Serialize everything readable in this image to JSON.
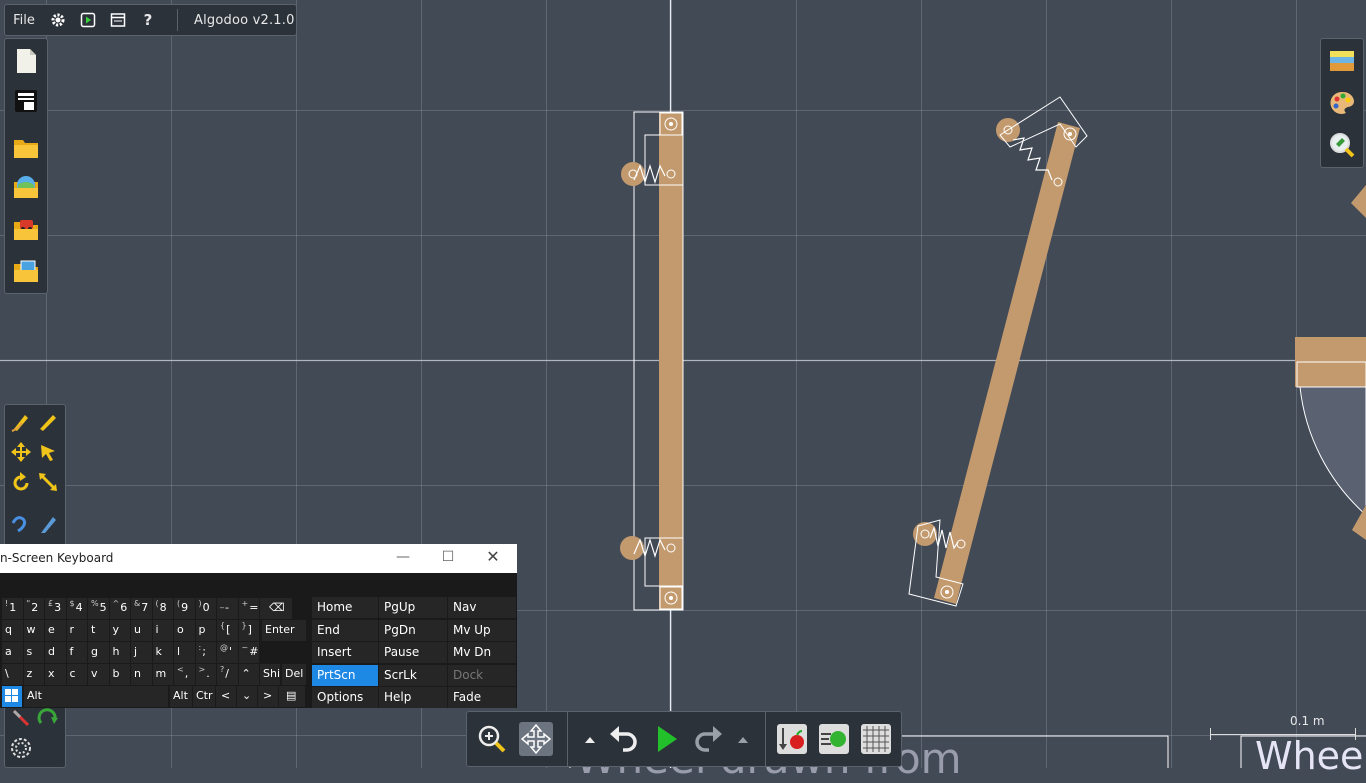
{
  "menubar": {
    "file_label": "File",
    "title": "Algodoo v2.1.0",
    "icons": [
      "gear-icon",
      "play-window-icon",
      "window-icon",
      "help-icon"
    ],
    "help_glyph": "?"
  },
  "left_toolbar": {
    "items": [
      "new-scene-icon",
      "scene-options-icon",
      "open-folder-icon",
      "open-web-icon",
      "phunlets-icon",
      "open-media-icon"
    ]
  },
  "draw_tools": {
    "items": [
      "sketch-tool-icon",
      "brush-tool-icon",
      "move-tool-icon",
      "drag-tool-icon",
      "rotate-tool-icon",
      "scale-tool-icon",
      "rope-tool-icon",
      "knife-tool-icon",
      "chain-tool-icon",
      "fixate-tool-icon",
      "spring-tool-icon"
    ]
  },
  "right_toolbar": {
    "items": [
      "background-icon",
      "palette-icon",
      "zoom-inspect-icon"
    ]
  },
  "osk": {
    "title": "n-Screen Keyboard",
    "row1": [
      {
        "sub": "!",
        "main": "1"
      },
      {
        "sub": "\"",
        "main": "2"
      },
      {
        "sub": "£",
        "main": "3"
      },
      {
        "sub": "$",
        "main": "4"
      },
      {
        "sub": "%",
        "main": "5"
      },
      {
        "sub": "^",
        "main": "6"
      },
      {
        "sub": "&",
        "main": "7"
      },
      {
        "sub": "(",
        "main": "8"
      },
      {
        "sub": "(",
        "main": "9"
      },
      {
        "sub": ")",
        "main": "0"
      },
      {
        "sub": "_",
        "main": "-"
      },
      {
        "sub": "+",
        "main": "="
      }
    ],
    "row2": [
      "q",
      "w",
      "e",
      "r",
      "t",
      "y",
      "u",
      "i",
      "o",
      "p"
    ],
    "row2_extra": [
      {
        "sub": "{",
        "main": "["
      },
      {
        "sub": "}",
        "main": "]"
      }
    ],
    "enter_label": "Enter",
    "row3": [
      "a",
      "s",
      "d",
      "f",
      "g",
      "h",
      "j",
      "k",
      "l"
    ],
    "row3_extra": [
      {
        "sub": ":",
        "main": ";"
      },
      {
        "sub": "@",
        "main": "'"
      },
      {
        "sub": "~",
        "main": "#"
      }
    ],
    "row4": [
      "\\",
      "z",
      "x",
      "c",
      "v",
      "b",
      "n",
      "m"
    ],
    "row4_extra": [
      {
        "sub": "<",
        "main": ","
      },
      {
        "sub": ">",
        "main": "."
      },
      {
        "sub": "?",
        "main": "/"
      }
    ],
    "shift_label": "Shi",
    "del_label": "Del",
    "alt_label": "Alt",
    "altgr_label": "Alt",
    "ctrl_label": "Ctr",
    "nav_keys": [
      [
        "Home",
        "PgUp",
        "Nav"
      ],
      [
        "End",
        "PgDn",
        "Mv Up"
      ],
      [
        "Insert",
        "Pause",
        "Mv Dn"
      ],
      [
        "PrtScn",
        "ScrLk",
        "Dock"
      ],
      [
        "Options",
        "Help",
        "Fade"
      ]
    ]
  },
  "simbar": {
    "items": [
      "zoom-icon",
      "pan-icon",
      "step-up-icon",
      "undo-icon",
      "play-icon",
      "redo-icon",
      "speed-up-icon",
      "gravity-icon",
      "air-friction-icon",
      "grid-icon"
    ]
  },
  "scale": {
    "label": "0.1 m"
  },
  "scene_text": {
    "left": "Wheel drawn from",
    "right": "Whee"
  },
  "colors": {
    "background": "#424a56",
    "wood": "#c39a6e",
    "play_green": "#22c02a",
    "accent_blue": "#1e88e5"
  }
}
